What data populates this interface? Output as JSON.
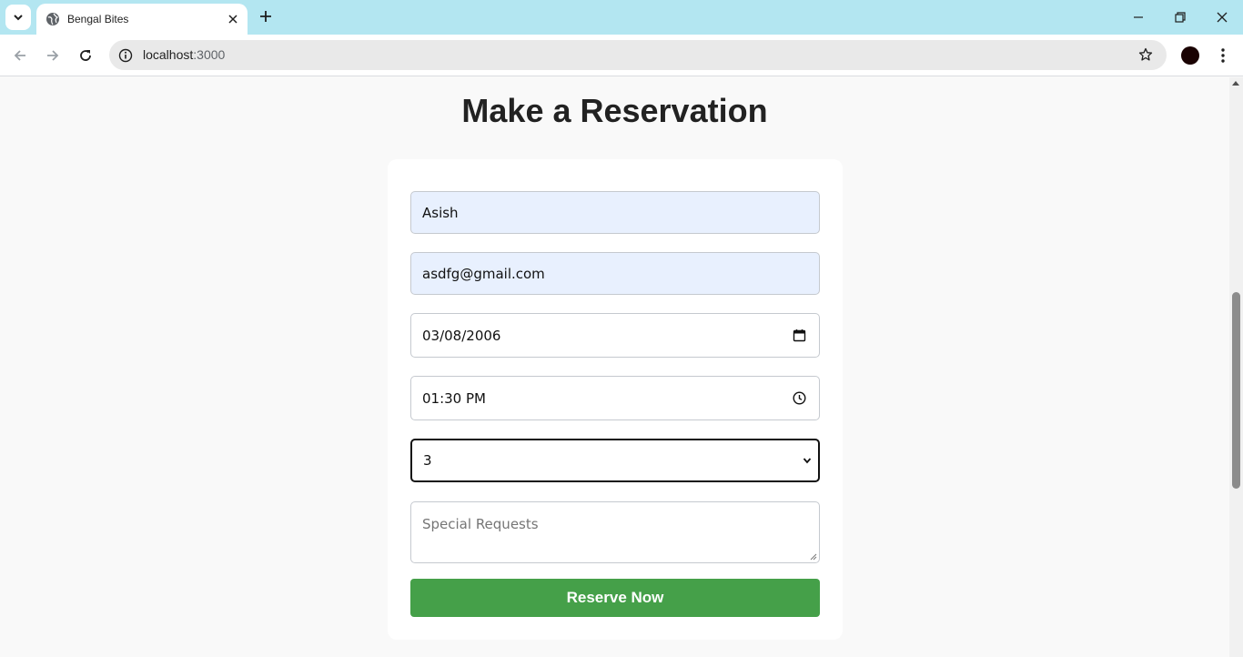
{
  "browser": {
    "tab_title": "Bengal Bites",
    "url_host": "localhost",
    "url_port": ":3000"
  },
  "page": {
    "title": "Make a Reservation"
  },
  "form": {
    "name_value": "Asish",
    "email_value": "asdfg@gmail.com",
    "date_value": "03/08/2006",
    "time_value": "01:30 PM",
    "guests_value": "3",
    "requests_placeholder": "Special Requests",
    "submit_label": "Reserve Now"
  },
  "colors": {
    "tabbar": "#b3e6f1",
    "submit": "#45a049",
    "autofill": "#e8f0fe"
  },
  "icons": {
    "tab_search": "chevron-down-icon",
    "favicon": "globe-icon",
    "tab_close": "close-icon",
    "new_tab": "plus-icon",
    "back": "arrow-left-icon",
    "forward": "arrow-right-icon",
    "reload": "reload-icon",
    "site_info": "info-icon",
    "bookmark": "star-icon",
    "menu": "kebab-menu-icon",
    "date_picker": "calendar-icon",
    "time_picker": "clock-icon",
    "select_arrow": "chevron-down-icon"
  }
}
